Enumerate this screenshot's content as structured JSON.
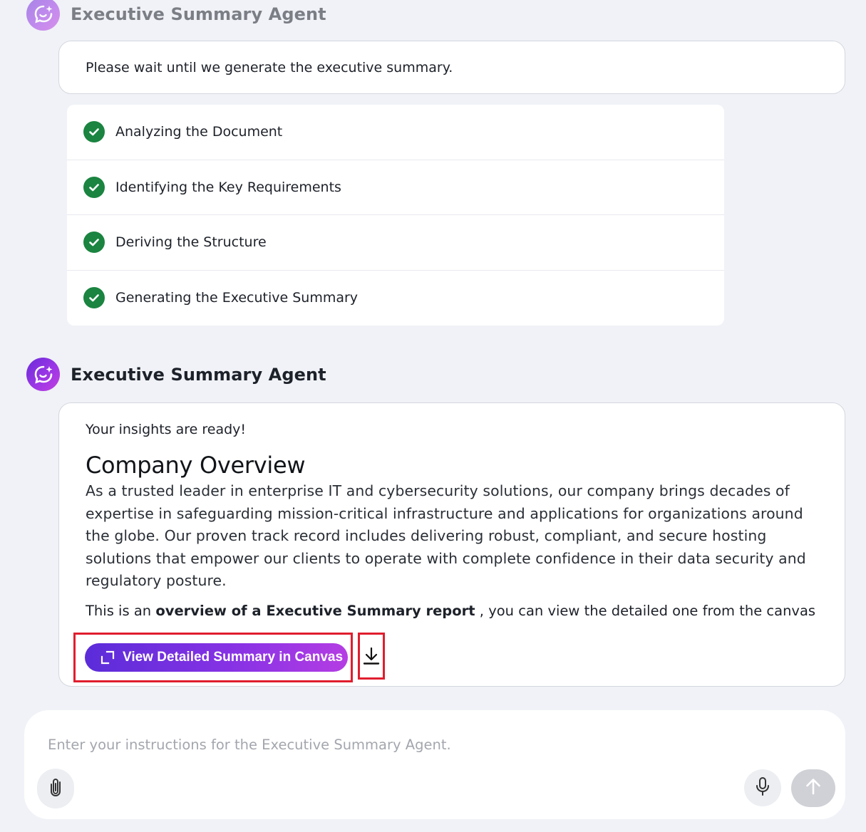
{
  "agent": {
    "name_top": "Executive Summary Agent",
    "name_main": "Executive Summary Agent"
  },
  "wait_message": "Please wait until we generate the executive summary.",
  "steps": [
    {
      "label": "Analyzing the Document",
      "status": "done"
    },
    {
      "label": "Identifying the Key Requirements",
      "status": "done"
    },
    {
      "label": "Deriving the Structure",
      "status": "done"
    },
    {
      "label": "Generating the Executive Summary",
      "status": "done"
    }
  ],
  "result": {
    "intro": "Your insights are ready!",
    "heading": "Company Overview",
    "paragraph": "As a trusted leader in enterprise IT and cybersecurity solutions, our company brings decades of expertise in safeguarding mission-critical infrastructure and applications for organizations around the globe. Our proven track record includes delivering robust, compliant, and secure hosting solutions that empower our clients to operate with complete confidence in their data security and regulatory posture.",
    "overview_prefix": "This is an ",
    "overview_bold": "overview of a Executive Summary report",
    "overview_suffix": " , you can view the detailed one from the canvas",
    "canvas_button_label": "View Detailed Summary in Canvas"
  },
  "composer": {
    "placeholder": "Enter your instructions for the Executive Summary Agent."
  },
  "icons": {
    "avatar": "chat-sparkle-icon",
    "step_status": "check-circle-icon",
    "canvas": "expand-icon",
    "download": "download-icon",
    "attach": "paperclip-icon",
    "mic": "microphone-icon",
    "send": "arrow-up-icon"
  },
  "colors": {
    "accent_start": "#5b2cd9",
    "accent_end": "#b53de4",
    "success": "#1a8440",
    "highlight_box": "#e01e2e",
    "background": "#f0f2f7"
  }
}
